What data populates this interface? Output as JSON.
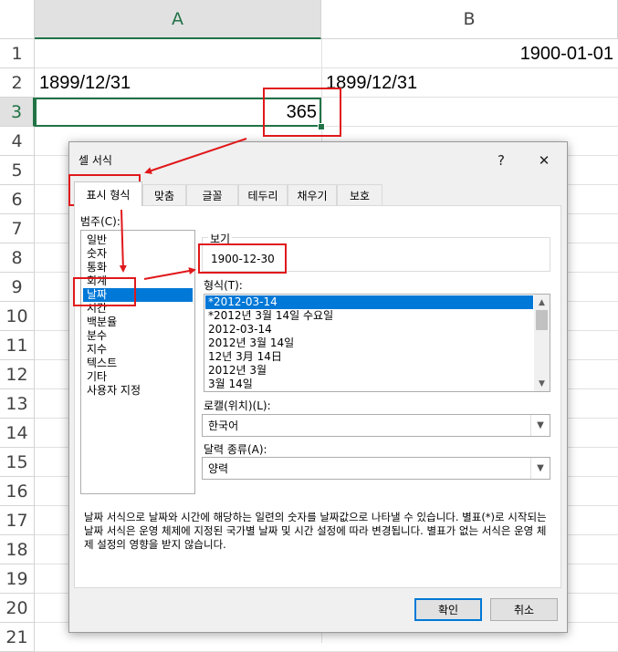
{
  "sheet": {
    "columns": [
      "A",
      "B"
    ],
    "selected_column": "A",
    "rows": [
      "1",
      "2",
      "3",
      "4",
      "5",
      "6",
      "7",
      "8",
      "9",
      "10",
      "11",
      "12",
      "13",
      "14",
      "15",
      "16",
      "17",
      "18",
      "19",
      "20",
      "21"
    ],
    "selected_row": "3",
    "cells": {
      "B1": "1900-01-01",
      "A2": "1899/12/31",
      "B2": "1899/12/31",
      "A3": "365"
    }
  },
  "dialog": {
    "title": "셀 서식",
    "help_label": "?",
    "close_label": "✕",
    "tabs": [
      "표시 형식",
      "맞춤",
      "글꼴",
      "테두리",
      "채우기",
      "보호"
    ],
    "active_tab": "표시 형식",
    "category_label": "범주(C):",
    "categories": [
      "일반",
      "숫자",
      "통화",
      "회계",
      "날짜",
      "시간",
      "백분율",
      "분수",
      "지수",
      "텍스트",
      "기타",
      "사용자 지정"
    ],
    "selected_category": "날짜",
    "sample_label": "보기",
    "sample_value": "1900-12-30",
    "format_label": "형식(T):",
    "formats": [
      "*2012-03-14",
      "*2012년 3월 14일 수요일",
      "2012-03-14",
      "2012년 3월 14일",
      "12년 3月 14日",
      "2012년 3월",
      "3월 14일"
    ],
    "selected_format": "*2012-03-14",
    "locale_label": "로캘(위치)(L):",
    "locale_value": "한국어",
    "calendar_label": "달력 종류(A):",
    "calendar_value": "양력",
    "description": "날짜 서식으로 날짜와 시간에 해당하는 일련의 숫자를 날짜값으로 나타낼 수 있습니다. 별표(*)로 시작되는 날짜 서식은 운영 체제에 지정된 국가별 날짜 및 시간 설정에 따라 변경됩니다. 별표가 없는 서식은 운영 체제 설정의 영향을 받지 않습니다.",
    "ok_label": "확인",
    "cancel_label": "취소"
  },
  "colors": {
    "excel_green": "#217346",
    "selection_blue": "#0078d7",
    "annotation_red": "#e0181b"
  }
}
